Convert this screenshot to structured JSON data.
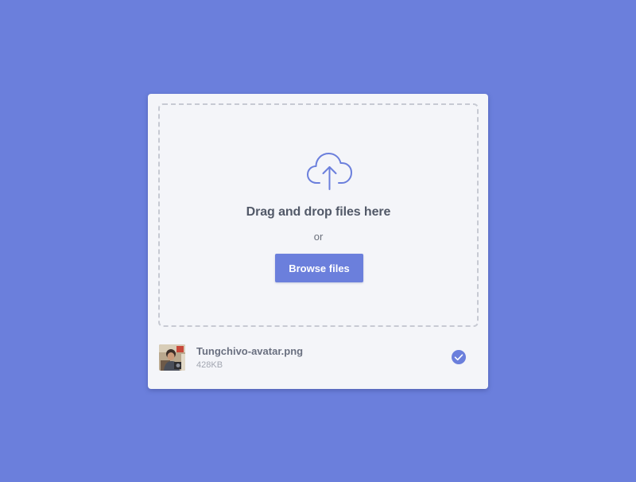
{
  "upload": {
    "title": "Drag and drop files here",
    "or_label": "or",
    "browse_label": "Browse files",
    "icon": "cloud-upload-icon"
  },
  "file": {
    "name": "Tungchivo-avatar.png",
    "size": "428KB",
    "status_icon": "check-circle-icon",
    "thumbnail_icon": "avatar-thumbnail"
  },
  "colors": {
    "background": "#6b7fdc",
    "card": "#f4f5f9",
    "accent": "#6b7fdc",
    "dashed_border": "#c7cad3",
    "title_text": "#525968",
    "muted_text": "#a2a6b1"
  }
}
